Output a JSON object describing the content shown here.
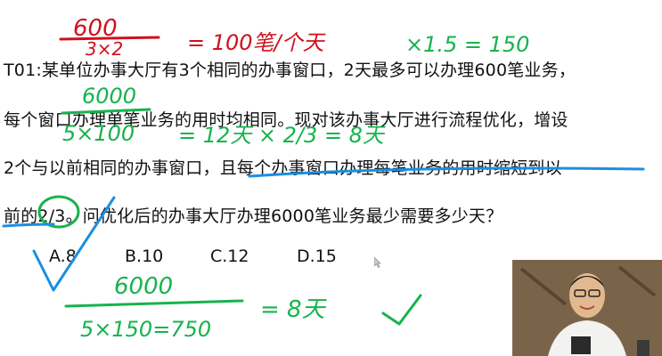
{
  "question": {
    "line1": "T01:某单位办事大厅有3个相同的办事窗口，2天最多可以办理600笔业务，",
    "line2": "每个窗口办理单笔业务的用时均相同。现对该办事大厅进行流程优化，增设",
    "line3": "2个与以前相同的办事窗口，且每个办事窗口办理每笔业务的用时缩短到以",
    "line4": "前的2/3。问优化后的办事大厅办理6000笔业务最少需要多少天？"
  },
  "options": [
    "A.8",
    "B.10",
    "C.12",
    "D.15"
  ],
  "annotations": {
    "top_fraction_num": "600",
    "top_fraction_den": "3×2",
    "top_result": "= 100笔/个天",
    "top_right": "×1.5 = 150",
    "mid_num": "6000",
    "mid_den": "5×100",
    "mid_result": "= 12天 × 2/3 = 8天",
    "bottom_num": "6000",
    "bottom_den": "5×150=750",
    "bottom_result": "= 8天"
  },
  "colors": {
    "red_ink": "#d0101e",
    "green_ink": "#17b34d",
    "blue_ink": "#1a8fe0",
    "text": "#111111"
  },
  "icons": [
    "mouse-cursor-icon",
    "checkmark-icon",
    "presenter-webcam"
  ]
}
